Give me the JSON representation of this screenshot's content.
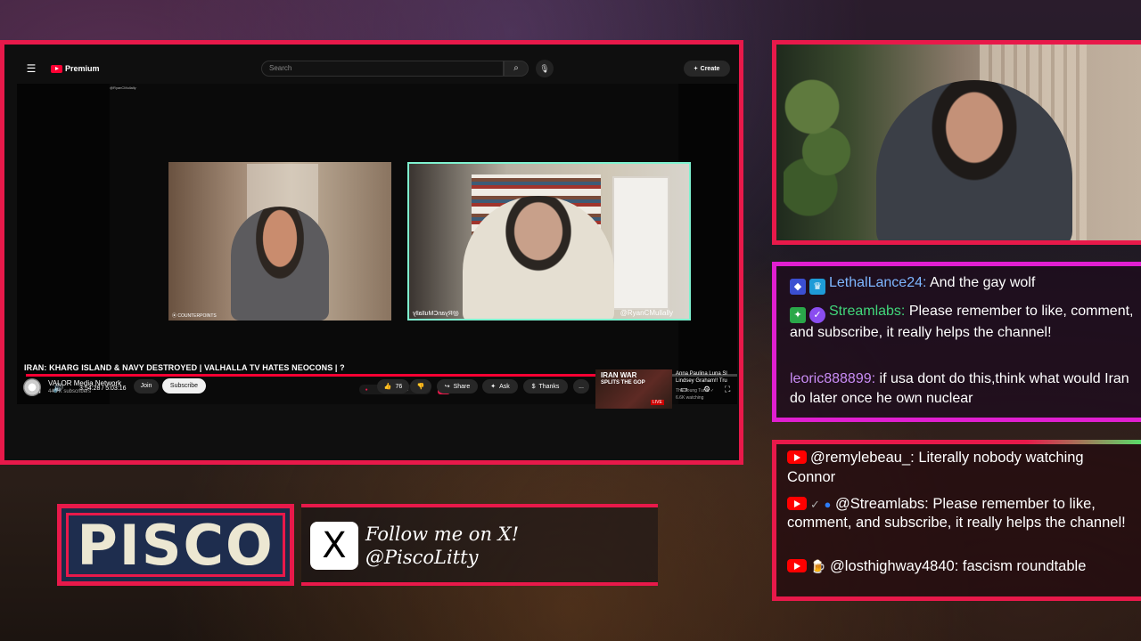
{
  "browser": {
    "logo_text": "Premium",
    "search_placeholder": "Search",
    "create_label": "Create"
  },
  "video": {
    "overlay_tag_left": "@RyanCMullally",
    "cam_left_caption": "⦿ COUNTERPOINTS",
    "cam_right_caption": "@RyanCMullally",
    "cam_right_mirror": "@RyanCMullally",
    "time": "3:54:28 / 5:03:16",
    "progress": 0.82,
    "title": "IRAN: KHARG ISLAND & NAVY DESTROYED | VALHALLA TV HATES NEOCONS | ?"
  },
  "channel": {
    "name": "VALOR Media Network",
    "subscribers": "44.7K subscribers",
    "join_label": "Join",
    "subscribe_label": "Subscribe"
  },
  "actions": {
    "likes": "76",
    "share": "Share",
    "ask": "Ask",
    "thanks": "Thanks",
    "more": "..."
  },
  "recommended": {
    "thumb_text_1": "IRAN WAR",
    "thumb_text_2": "SPLITS THE GOP",
    "live_label": "LIVE",
    "title_line1": "Anna Paulina Luna Sl",
    "title_line2": "Lindsey Graham!! Tru",
    "channel": "The Young Turks ✓",
    "watching": "6.6K watching"
  },
  "chat_top": [
    {
      "user": "LethalLance24:",
      "text": "And the gay wolf",
      "color": "#7eb6ff"
    },
    {
      "user": "Streamlabs:",
      "text": "Please remember to like, comment, and subscribe, it really helps the channel!",
      "color": "#41d67a"
    },
    {
      "user": "leoric888899:",
      "text": "if usa dont do this,think what would Iran do later once he own nuclear",
      "color": "#c98cf5"
    }
  ],
  "chat_bottom": [
    {
      "user": "@remylebeau_:",
      "text": "Literally nobody watching Connor"
    },
    {
      "user": "@Streamlabs:",
      "text": "Please remember to like, comment, and subscribe, it really helps the channel!"
    },
    {
      "user": "@losthighway4840:",
      "text": "fascism roundtable"
    }
  ],
  "branding": {
    "name": "PISCO",
    "follow_line1": "Follow me on X!",
    "follow_line2": "@PiscoLitty",
    "x_glyph": "X"
  },
  "colors": {
    "frame_red": "#e8194a",
    "frame_magenta": "#e01fd0",
    "youtube_red": "#ff0033"
  }
}
